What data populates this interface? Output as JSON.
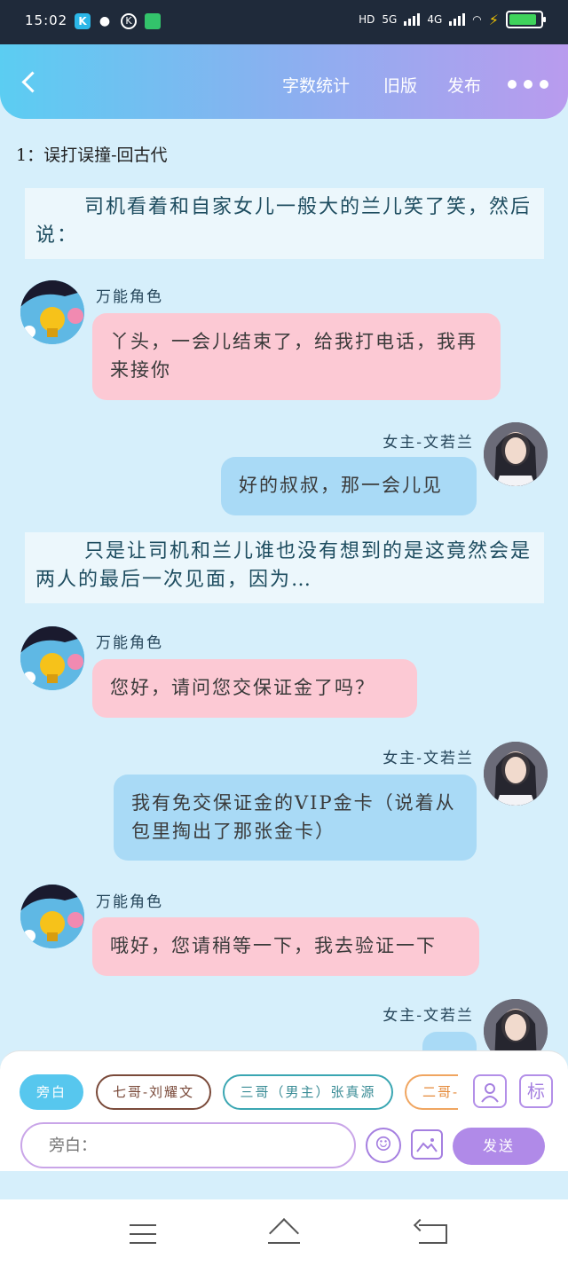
{
  "status_bar": {
    "time": "15:02",
    "network_label": "HD",
    "net_5g": "5G",
    "net_4g": "4G",
    "battery_level": "91"
  },
  "header": {
    "word_count": "字数统计",
    "old_version": "旧版",
    "publish": "发布"
  },
  "chapter_title": "1：误打误撞-回古代",
  "messages": [
    {
      "type": "narration",
      "text": "司机看着和自家女儿一般大的兰儿笑了笑，然后说："
    },
    {
      "type": "left",
      "speaker": "万能角色",
      "text": "丫头，一会儿结束了，给我打电话，我再来接你"
    },
    {
      "type": "right",
      "speaker": "女主-文若兰",
      "text": "好的叔叔，那一会儿见"
    },
    {
      "type": "narration",
      "text": "只是让司机和兰儿谁也没有想到的是这竟然会是两人的最后一次见面，因为…"
    },
    {
      "type": "left",
      "speaker": "万能角色",
      "text": "您好，请问您交保证金了吗？"
    },
    {
      "type": "right",
      "speaker": "女主-文若兰",
      "text": "我有免交保证金的VIP金卡（说着从包里掏出了那张金卡）"
    },
    {
      "type": "left",
      "speaker": "万能角色",
      "text": "哦好，您请稍等一下，我去验证一下"
    },
    {
      "type": "right",
      "speaker": "女主-文若兰",
      "text": ""
    }
  ],
  "composer": {
    "roles": [
      "旁白",
      "七哥-刘耀文",
      "三哥（男主）张真源",
      "二哥-"
    ],
    "input_placeholder": "旁白：",
    "send_label": "发送",
    "mark_label": "标"
  }
}
